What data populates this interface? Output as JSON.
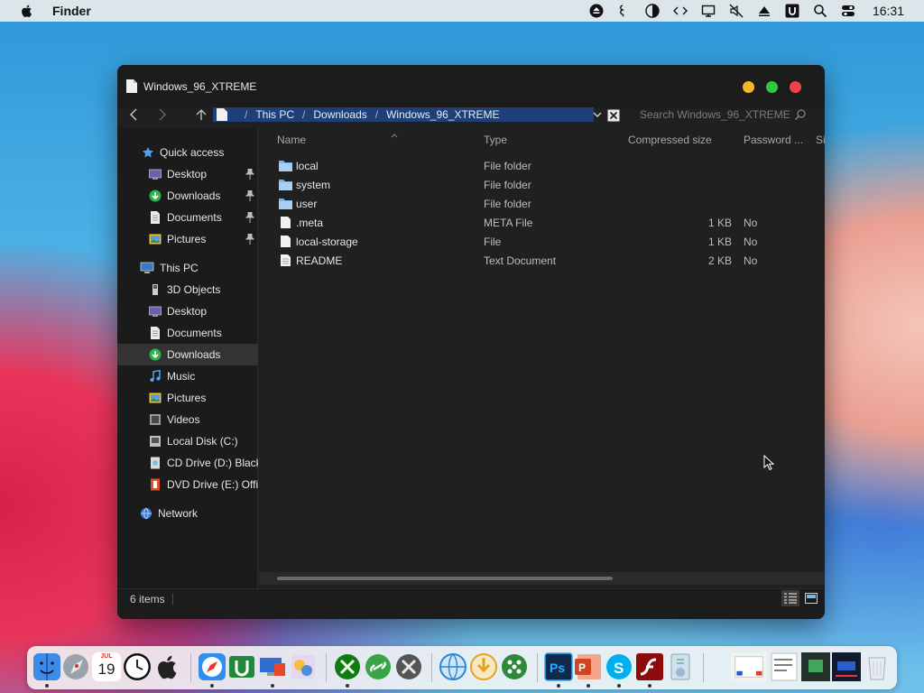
{
  "menubar": {
    "app_name": "Finder",
    "clock": "16:31",
    "status_icons": [
      "eject-icon",
      "audio-icon",
      "dark-mode-icon",
      "code-icon",
      "display-icon",
      "mute-icon",
      "triangle-icon",
      "u-icon",
      "search-icon",
      "control-center-icon"
    ]
  },
  "window": {
    "title": "Windows_96_XTREME",
    "address": {
      "segments": [
        "This PC",
        "Downloads",
        "Windows_96_XTREME"
      ],
      "separator": "/"
    },
    "search_placeholder": "Search Windows_96_XTREME",
    "sidebar": {
      "quick_access": "Quick access",
      "quick_items": [
        {
          "label": "Desktop",
          "icon": "desktop-icon",
          "pinned": true
        },
        {
          "label": "Downloads",
          "icon": "downloads-icon",
          "pinned": true
        },
        {
          "label": "Documents",
          "icon": "documents-icon",
          "pinned": true
        },
        {
          "label": "Pictures",
          "icon": "pictures-icon",
          "pinned": true
        }
      ],
      "this_pc": "This PC",
      "pc_items": [
        {
          "label": "3D Objects",
          "icon": "3d-objects-icon"
        },
        {
          "label": "Desktop",
          "icon": "desktop-icon"
        },
        {
          "label": "Documents",
          "icon": "documents-icon"
        },
        {
          "label": "Downloads",
          "icon": "downloads-icon",
          "selected": true
        },
        {
          "label": "Music",
          "icon": "music-icon"
        },
        {
          "label": "Pictures",
          "icon": "pictures-icon"
        },
        {
          "label": "Videos",
          "icon": "videos-icon"
        },
        {
          "label": "Local Disk (C:)",
          "icon": "local-disk-icon"
        },
        {
          "label": "CD Drive (D:) Black",
          "icon": "cd-drive-icon"
        },
        {
          "label": "DVD Drive (E:) Offic",
          "icon": "dvd-drive-icon"
        }
      ],
      "network": "Network"
    },
    "columns": {
      "name": "Name",
      "type": "Type",
      "compressed_size": "Compressed size",
      "password": "Password ...",
      "size_cut": "Si"
    },
    "files": [
      {
        "name": "local",
        "type": "File folder",
        "size": "",
        "password": "",
        "icon": "folder-icon"
      },
      {
        "name": "system",
        "type": "File folder",
        "size": "",
        "password": "",
        "icon": "folder-icon"
      },
      {
        "name": "user",
        "type": "File folder",
        "size": "",
        "password": "",
        "icon": "folder-icon"
      },
      {
        "name": ".meta",
        "type": "META File",
        "size": "1 KB",
        "password": "No",
        "icon": "file-icon"
      },
      {
        "name": "local-storage",
        "type": "File",
        "size": "1 KB",
        "password": "No",
        "icon": "file-icon"
      },
      {
        "name": "README",
        "type": "Text Document",
        "size": "2 KB",
        "password": "No",
        "icon": "text-file-icon"
      }
    ],
    "status": {
      "item_count": "6 items"
    }
  },
  "dock": {
    "calendar_month": "JUL",
    "calendar_day": "19",
    "apps": [
      "finder-icon",
      "launchpad-icon",
      "calendar-icon",
      "clock-icon",
      "apple-icon",
      "safari-icon",
      "utorrent-icon",
      "remote-desktop-icon",
      "books-icon",
      "preview-icon",
      "xbox-icon",
      "link-icon",
      "tools-icon",
      "www-icon",
      "download-icon",
      "dots-icon",
      "photoshop-icon",
      "powerpoint-icon",
      "skype-icon",
      "flash-icon",
      "installer-icon",
      "window-thumb-1",
      "window-thumb-2",
      "window-thumb-3",
      "window-thumb-4",
      "trash-icon"
    ]
  },
  "colors": {
    "address_highlight": "#1f3f78",
    "window_bg": "#202020",
    "sidebar_selected": "#333333"
  }
}
